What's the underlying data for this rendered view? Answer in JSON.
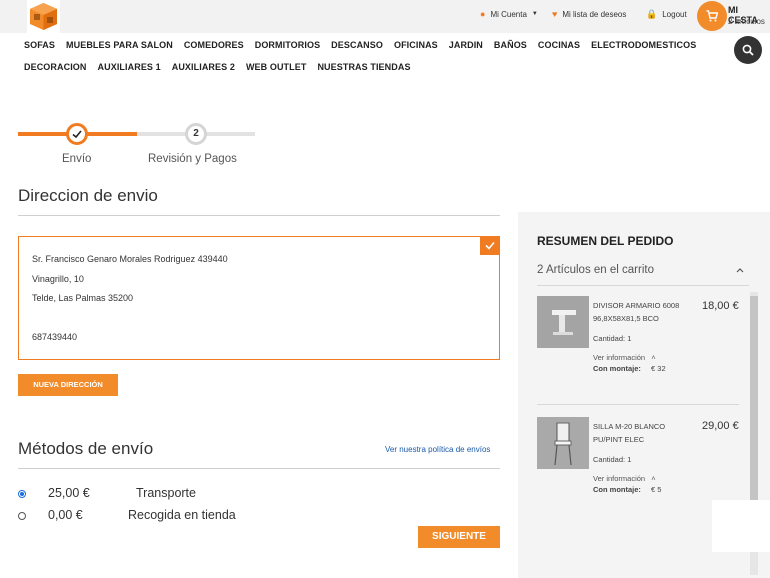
{
  "topbar": {
    "account": "Mi Cuenta",
    "wishlist": "Mi lista de deseos",
    "logout": "Logout",
    "cart_title": "MI CESTA",
    "cart_count": "2 artículos"
  },
  "nav": {
    "row1": [
      "SOFAS",
      "MUEBLES PARA SALON",
      "COMEDORES",
      "DORMITORIOS",
      "DESCANSO",
      "OFICINAS",
      "JARDIN",
      "BAÑOS",
      "COCINAS",
      "ELECTRODOMESTICOS"
    ],
    "row2": [
      "DECORACION",
      "AUXILIARES 1",
      "AUXILIARES 2",
      "WEB OUTLET",
      "NUESTRAS TIENDAS"
    ]
  },
  "stepper": {
    "step1_label": "Envío",
    "step2_number": "2",
    "step2_label": "Revisión y Pagos"
  },
  "address": {
    "heading": "Direccion de envio",
    "lines": [
      "Sr. Francisco Genaro Morales Rodriguez 439440",
      "Vinagrillo, 10",
      "Telde, Las Palmas 35200",
      "687439440"
    ],
    "new_button": "NUEVA DIRECCIÓN"
  },
  "shipping": {
    "heading": "Métodos de envío",
    "policy_link": "Ver nuestra política de envíos",
    "options": [
      {
        "price": "25,00 €",
        "name": "Transporte",
        "selected": true
      },
      {
        "price": "0,00 €",
        "name": "Recogida en tienda",
        "selected": false
      }
    ],
    "next_button": "SIGUIENTE"
  },
  "summary": {
    "title": "RESUMEN DEL PEDIDO",
    "count": "2 Artículos en el carrito",
    "items": [
      {
        "name": "DIVISOR ARMARIO 6008 96,8X58X81,5 BCO",
        "price": "18,00 €",
        "qty": "Cantidad: 1",
        "more": "Ver información",
        "mount_label": "Con montaje:",
        "mount_value": "€ 32"
      },
      {
        "name": "SILLA M-20 BLANCO PU/PINT ELEC",
        "price": "29,00 €",
        "qty": "Cantidad: 1",
        "more": "Ver información",
        "mount_label": "Con montaje:",
        "mount_value": "€ 5"
      }
    ]
  },
  "colors": {
    "accent": "#f07b20",
    "button": "#f28b2a",
    "link": "#1a5aa8"
  },
  "icons": [
    "logo-box-icon",
    "user-icon",
    "heart-icon",
    "lock-icon",
    "cart-icon",
    "search-icon",
    "check-icon",
    "chevron-up-icon",
    "caret-down-icon"
  ]
}
